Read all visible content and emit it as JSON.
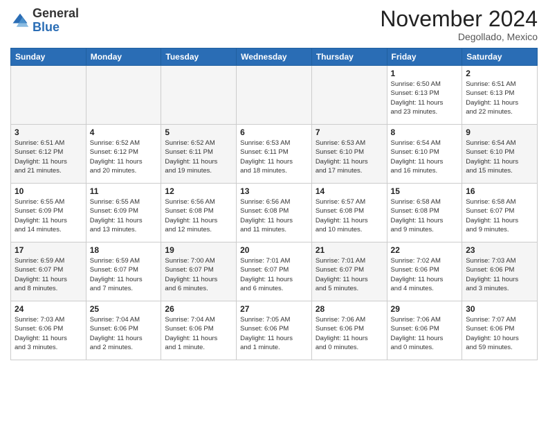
{
  "header": {
    "logo": {
      "general": "General",
      "blue": "Blue"
    },
    "title": "November 2024",
    "location": "Degollado, Mexico"
  },
  "weekdays": [
    "Sunday",
    "Monday",
    "Tuesday",
    "Wednesday",
    "Thursday",
    "Friday",
    "Saturday"
  ],
  "weeks": [
    [
      {
        "day": "",
        "info": "",
        "empty": true
      },
      {
        "day": "",
        "info": "",
        "empty": true
      },
      {
        "day": "",
        "info": "",
        "empty": true
      },
      {
        "day": "",
        "info": "",
        "empty": true
      },
      {
        "day": "",
        "info": "",
        "empty": true
      },
      {
        "day": "1",
        "info": "Sunrise: 6:50 AM\nSunset: 6:13 PM\nDaylight: 11 hours\nand 23 minutes."
      },
      {
        "day": "2",
        "info": "Sunrise: 6:51 AM\nSunset: 6:13 PM\nDaylight: 11 hours\nand 22 minutes."
      }
    ],
    [
      {
        "day": "3",
        "info": "Sunrise: 6:51 AM\nSunset: 6:12 PM\nDaylight: 11 hours\nand 21 minutes."
      },
      {
        "day": "4",
        "info": "Sunrise: 6:52 AM\nSunset: 6:12 PM\nDaylight: 11 hours\nand 20 minutes."
      },
      {
        "day": "5",
        "info": "Sunrise: 6:52 AM\nSunset: 6:11 PM\nDaylight: 11 hours\nand 19 minutes."
      },
      {
        "day": "6",
        "info": "Sunrise: 6:53 AM\nSunset: 6:11 PM\nDaylight: 11 hours\nand 18 minutes."
      },
      {
        "day": "7",
        "info": "Sunrise: 6:53 AM\nSunset: 6:10 PM\nDaylight: 11 hours\nand 17 minutes."
      },
      {
        "day": "8",
        "info": "Sunrise: 6:54 AM\nSunset: 6:10 PM\nDaylight: 11 hours\nand 16 minutes."
      },
      {
        "day": "9",
        "info": "Sunrise: 6:54 AM\nSunset: 6:10 PM\nDaylight: 11 hours\nand 15 minutes."
      }
    ],
    [
      {
        "day": "10",
        "info": "Sunrise: 6:55 AM\nSunset: 6:09 PM\nDaylight: 11 hours\nand 14 minutes."
      },
      {
        "day": "11",
        "info": "Sunrise: 6:55 AM\nSunset: 6:09 PM\nDaylight: 11 hours\nand 13 minutes."
      },
      {
        "day": "12",
        "info": "Sunrise: 6:56 AM\nSunset: 6:08 PM\nDaylight: 11 hours\nand 12 minutes."
      },
      {
        "day": "13",
        "info": "Sunrise: 6:56 AM\nSunset: 6:08 PM\nDaylight: 11 hours\nand 11 minutes."
      },
      {
        "day": "14",
        "info": "Sunrise: 6:57 AM\nSunset: 6:08 PM\nDaylight: 11 hours\nand 10 minutes."
      },
      {
        "day": "15",
        "info": "Sunrise: 6:58 AM\nSunset: 6:08 PM\nDaylight: 11 hours\nand 9 minutes."
      },
      {
        "day": "16",
        "info": "Sunrise: 6:58 AM\nSunset: 6:07 PM\nDaylight: 11 hours\nand 9 minutes."
      }
    ],
    [
      {
        "day": "17",
        "info": "Sunrise: 6:59 AM\nSunset: 6:07 PM\nDaylight: 11 hours\nand 8 minutes."
      },
      {
        "day": "18",
        "info": "Sunrise: 6:59 AM\nSunset: 6:07 PM\nDaylight: 11 hours\nand 7 minutes."
      },
      {
        "day": "19",
        "info": "Sunrise: 7:00 AM\nSunset: 6:07 PM\nDaylight: 11 hours\nand 6 minutes."
      },
      {
        "day": "20",
        "info": "Sunrise: 7:01 AM\nSunset: 6:07 PM\nDaylight: 11 hours\nand 6 minutes."
      },
      {
        "day": "21",
        "info": "Sunrise: 7:01 AM\nSunset: 6:07 PM\nDaylight: 11 hours\nand 5 minutes."
      },
      {
        "day": "22",
        "info": "Sunrise: 7:02 AM\nSunset: 6:06 PM\nDaylight: 11 hours\nand 4 minutes."
      },
      {
        "day": "23",
        "info": "Sunrise: 7:03 AM\nSunset: 6:06 PM\nDaylight: 11 hours\nand 3 minutes."
      }
    ],
    [
      {
        "day": "24",
        "info": "Sunrise: 7:03 AM\nSunset: 6:06 PM\nDaylight: 11 hours\nand 3 minutes."
      },
      {
        "day": "25",
        "info": "Sunrise: 7:04 AM\nSunset: 6:06 PM\nDaylight: 11 hours\nand 2 minutes."
      },
      {
        "day": "26",
        "info": "Sunrise: 7:04 AM\nSunset: 6:06 PM\nDaylight: 11 hours\nand 1 minute."
      },
      {
        "day": "27",
        "info": "Sunrise: 7:05 AM\nSunset: 6:06 PM\nDaylight: 11 hours\nand 1 minute."
      },
      {
        "day": "28",
        "info": "Sunrise: 7:06 AM\nSunset: 6:06 PM\nDaylight: 11 hours\nand 0 minutes."
      },
      {
        "day": "29",
        "info": "Sunrise: 7:06 AM\nSunset: 6:06 PM\nDaylight: 11 hours\nand 0 minutes."
      },
      {
        "day": "30",
        "info": "Sunrise: 7:07 AM\nSunset: 6:06 PM\nDaylight: 10 hours\nand 59 minutes."
      }
    ]
  ]
}
